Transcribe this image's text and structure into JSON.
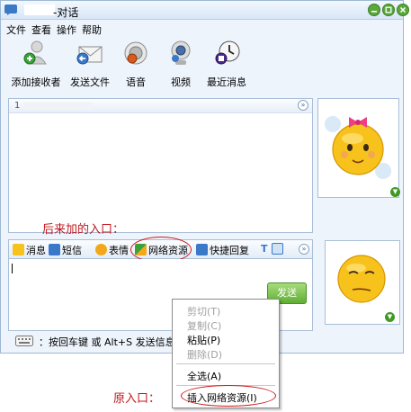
{
  "window": {
    "title_suffix": "-对话"
  },
  "menu": [
    "文件",
    "查看",
    "操作",
    "帮助"
  ],
  "toolbar": [
    {
      "label": "添加接收者",
      "icon": "add-contact-icon"
    },
    {
      "label": "发送文件",
      "icon": "send-file-icon"
    },
    {
      "label": "语音",
      "icon": "voice-icon"
    },
    {
      "label": "视频",
      "icon": "video-icon"
    },
    {
      "label": "最近消息",
      "icon": "recent-messages-icon"
    }
  ],
  "history": {
    "line_number": "1"
  },
  "compose_toolbar": [
    {
      "label": "消息",
      "icon": "message-icon"
    },
    {
      "label": "短信",
      "icon": "sms-icon"
    },
    {
      "label": "表情",
      "icon": "emoticon-icon"
    },
    {
      "label": "网络资源",
      "icon": "web-resource-icon"
    },
    {
      "label": "快捷回复",
      "icon": "quick-reply-icon"
    }
  ],
  "send_button": "发送",
  "status": {
    "hint": "：按回车键 或 Alt+S 发送信息，"
  },
  "context_menu": {
    "cut": "剪切(T)",
    "copy": "复制(C)",
    "paste": "粘贴(P)",
    "delete": "删除(D)",
    "select_all": "全选(A)",
    "insert_web_resource": "插入网络资源(I)"
  },
  "annotations": {
    "new_entry": "后来加的入口：",
    "original_entry": "原入口："
  },
  "colors": {
    "annotation_red": "#c0171d",
    "send_green": "#5fae33",
    "window_bg": "#eef4fc"
  }
}
